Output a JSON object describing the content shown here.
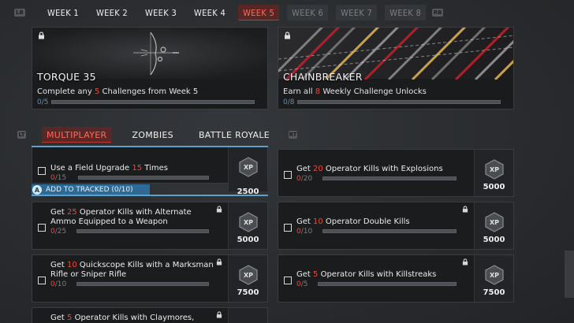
{
  "weeks": {
    "lb": "LB",
    "rb": "RB",
    "tabs": [
      "WEEK 1",
      "WEEK 2",
      "WEEK 3",
      "WEEK 4",
      "WEEK 5",
      "WEEK 6",
      "WEEK 7",
      "WEEK 8"
    ],
    "active_index": 4
  },
  "rewards": [
    {
      "name": "TORQUE 35",
      "desc_pre": "Complete any ",
      "desc_num": "5",
      "desc_post": " Challenges from Week 5",
      "prog_cur": "0",
      "prog_tot": "/5"
    },
    {
      "name": "CHAINBREAKER",
      "desc_pre": "Earn all ",
      "desc_num": "8",
      "desc_post": " Weekly Challenge Unlocks",
      "prog_cur": "0",
      "prog_tot": "/8"
    }
  ],
  "modes": {
    "lt": "LT",
    "rt": "RT",
    "tabs": [
      "MULTIPLAYER",
      "ZOMBIES",
      "BATTLE ROYALE"
    ],
    "active_index": 0
  },
  "tracked": {
    "button": "A",
    "label": "ADD TO TRACKED (0/10)"
  },
  "challenges": [
    {
      "pre": "Use a Field Upgrade ",
      "num": "15",
      "post": " Times",
      "cur": "0",
      "tot": "/15",
      "xp": "2500"
    },
    {
      "pre": "Get ",
      "num": "20",
      "post": " Operator Kills with Explosions",
      "cur": "0",
      "tot": "/20",
      "xp": "5000"
    },
    {
      "pre": "Get ",
      "num": "25",
      "post": " Operator Kills with Alternate Ammo Equipped to a Weapon",
      "cur": "0",
      "tot": "/25",
      "xp": "5000"
    },
    {
      "pre": "Get ",
      "num": "10",
      "post": " Operator Double Kills",
      "cur": "0",
      "tot": "/10",
      "xp": "5000"
    },
    {
      "pre": "Get ",
      "num": "10",
      "post": " Quickscope Kills with a Marksman Rifle or Sniper Rifle",
      "cur": "0",
      "tot": "/10",
      "xp": "7500"
    },
    {
      "pre": "Get ",
      "num": "5",
      "post": " Operator Kills with Killstreaks",
      "cur": "0",
      "tot": "/5",
      "xp": "7500"
    },
    {
      "pre": "Get ",
      "num": "5",
      "post": " Operator Kills with Claymores,",
      "cur": "",
      "tot": "",
      "xp": ""
    }
  ],
  "colors": {
    "accent_red": "#e74c3c",
    "tracked_blue": "#2d6a95",
    "select_blue": "#5fa0c8"
  },
  "icons": [
    "lock-icon",
    "xp-token-icon",
    "checkbox-icon",
    "compound-bow-icon"
  ]
}
